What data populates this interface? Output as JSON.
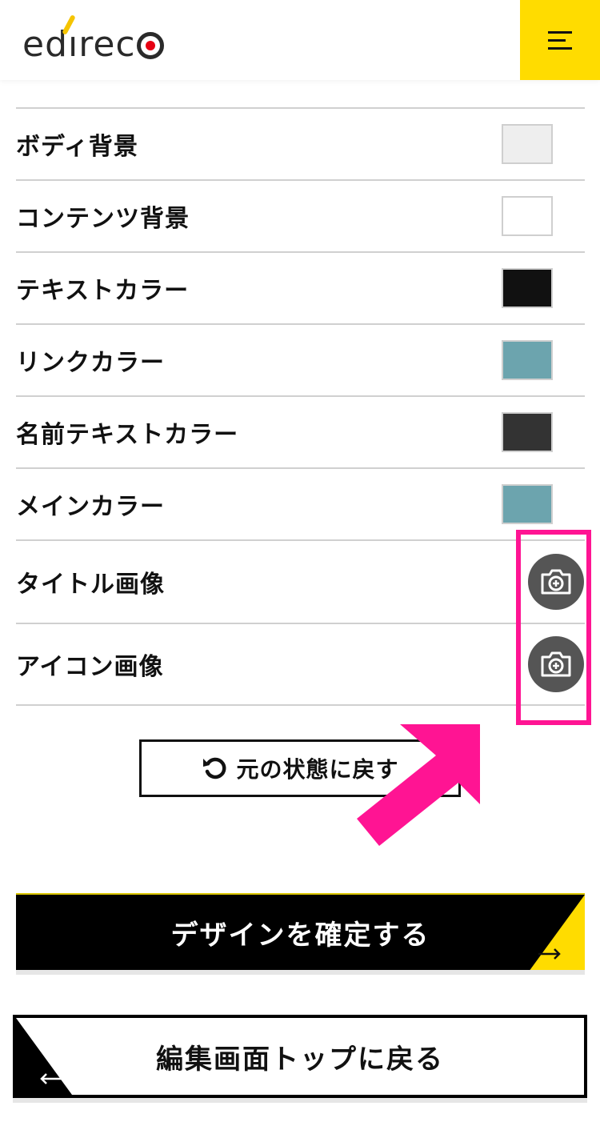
{
  "header": {
    "logo_text": "edireco",
    "menu_icon": "hamburger-menu-icon"
  },
  "settings": [
    {
      "label": "ボディ背景",
      "type": "color",
      "color": "#eeeeee"
    },
    {
      "label": "コンテンツ背景",
      "type": "color",
      "color": "#ffffff"
    },
    {
      "label": "テキストカラー",
      "type": "color",
      "color": "#111111"
    },
    {
      "label": "リンクカラー",
      "type": "color",
      "color": "#6ca4ae"
    },
    {
      "label": "名前テキストカラー",
      "type": "color",
      "color": "#333333"
    },
    {
      "label": "メインカラー",
      "type": "color",
      "color": "#6ca4ae"
    },
    {
      "label": "タイトル画像",
      "type": "image",
      "icon": "camera-add-icon"
    },
    {
      "label": "アイコン画像",
      "type": "image",
      "icon": "camera-add-icon"
    }
  ],
  "reset_button": {
    "label": "元の状態に戻す",
    "icon": "undo-icon"
  },
  "confirm_button": {
    "label": "デザインを確定する",
    "icon": "arrow-right-icon"
  },
  "back_button": {
    "label": "編集画面トップに戻る",
    "icon": "arrow-left-icon"
  },
  "colors": {
    "accent_yellow": "#ffdc00",
    "highlight_pink": "#ff1493",
    "camera_button": "#555555"
  }
}
